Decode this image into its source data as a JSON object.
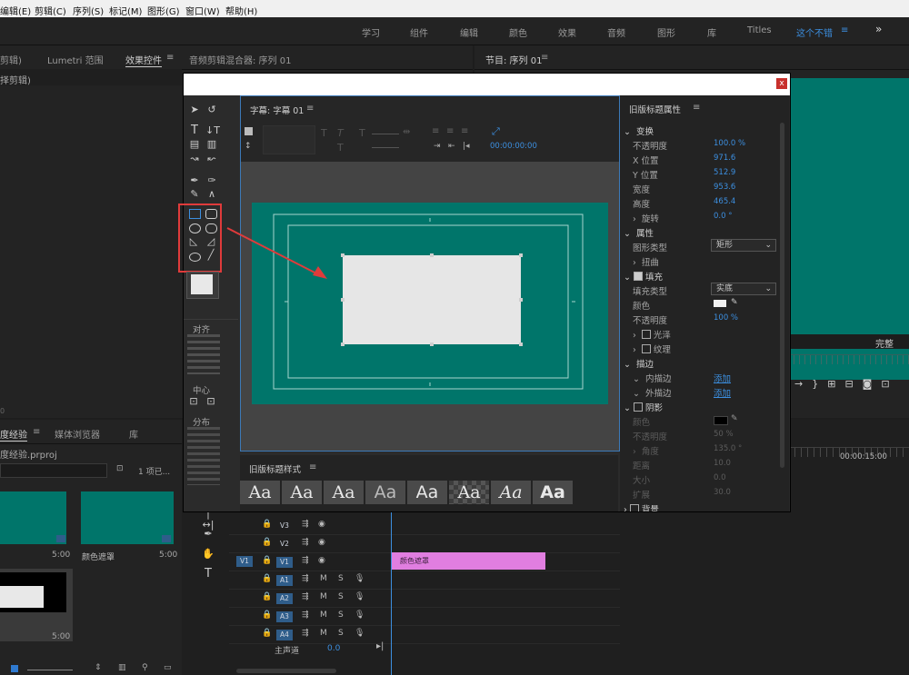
{
  "menubar": [
    "编辑(E)",
    "剪辑(C)",
    "序列(S)",
    "标记(M)",
    "图形(G)",
    "窗口(W)",
    "帮助(H)"
  ],
  "workspaces": [
    "学习",
    "组件",
    "编辑",
    "颜色",
    "效果",
    "音频",
    "图形",
    "库",
    "Titles",
    "这个不错"
  ],
  "workspace_active_menu": "≡",
  "workspace_more": "»",
  "left_panel": {
    "tabs": [
      "剪辑)",
      "Lumetri 范围",
      "效果控件",
      "音频剪辑混合器: 序列 01"
    ],
    "subtitle": "择剪辑)",
    "menu_icon": "≡"
  },
  "program_monitor": {
    "title": "节目: 序列 01",
    "menu_icon": "≡",
    "zoom": "完整",
    "timecode": "00:00:15:00"
  },
  "project_panel": {
    "tabs": [
      "度经验",
      "媒体浏览器",
      "库"
    ],
    "file": "度经验.prproj",
    "count": "1 项已...",
    "items": [
      {
        "name": "",
        "duration": "5:00"
      },
      {
        "name": "颜色遮罩",
        "duration": "5:00"
      },
      {
        "name": "",
        "duration": "5:00"
      }
    ]
  },
  "title_dialog": {
    "close": "x",
    "canvas_title": "字幕: 字幕 01",
    "timecode": "00:00:00:00",
    "align_label": "对齐",
    "center_label": "中心",
    "distribute_label": "分布",
    "styles_title": "旧版标题样式",
    "style_samples": [
      "Aa",
      "Aa",
      "Aa",
      "Aa",
      "Aa",
      "Aa",
      "Aa",
      "Aa"
    ],
    "props_title": "旧版标题属性",
    "props": {
      "transform": "变换",
      "opacity_l": "不透明度",
      "opacity_v": "100.0 %",
      "x_l": "X 位置",
      "x_v": "971.6",
      "y_l": "Y 位置",
      "y_v": "512.9",
      "w_l": "宽度",
      "w_v": "953.6",
      "h_l": "高度",
      "h_v": "465.4",
      "rot_l": "旋转",
      "rot_v": "0.0 °",
      "attrs": "属性",
      "shape_l": "图形类型",
      "shape_v": "矩形",
      "distort": "扭曲",
      "fill": "填充",
      "filltype_l": "填充类型",
      "filltype_v": "实底",
      "color_l": "颜色",
      "fillop_l": "不透明度",
      "fillop_v": "100 %",
      "gloss": "光泽",
      "texture": "纹理",
      "stroke": "描边",
      "inner_l": "内描边",
      "inner_v": "添加",
      "outer_l": "外描边",
      "outer_v": "添加",
      "shadow": "阴影",
      "sh_color": "颜色",
      "sh_op_l": "不透明度",
      "sh_op_v": "50 %",
      "sh_ang_l": "角度",
      "sh_ang_v": "135.0 °",
      "sh_dist_l": "距离",
      "sh_dist_v": "10.0",
      "sh_size_l": "大小",
      "sh_size_v": "0.0",
      "sh_spread_l": "扩展",
      "sh_spread_v": "30.0",
      "bg": "背景"
    }
  },
  "timeline": {
    "clip": "颜色遮罩",
    "tracks": [
      "V3",
      "V2",
      "V1",
      "A1",
      "A2",
      "A3",
      "A4"
    ],
    "source_patch": "V1",
    "master": "主声道",
    "master_v": "0.0"
  },
  "colors": {
    "accent": "#3c8fe0",
    "teal": "#00756a",
    "clip": "#e17ee0",
    "highlight": "#e03b3b"
  }
}
